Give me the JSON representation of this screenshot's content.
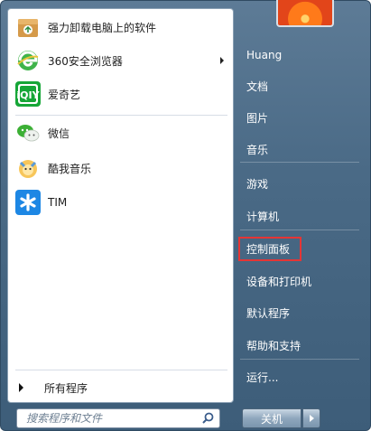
{
  "left_items": [
    {
      "label": "强力卸载电脑上的软件",
      "icon": "uninstall-box-icon",
      "has_arrow": false
    },
    {
      "label": "360安全浏览器",
      "icon": "browser-360-icon",
      "has_arrow": true
    },
    {
      "label": "爱奇艺",
      "icon": "iqiyi-icon",
      "has_arrow": false
    },
    {
      "label": "微信",
      "icon": "wechat-icon",
      "has_arrow": false
    },
    {
      "label": "酷我音乐",
      "icon": "kuwo-music-icon",
      "has_arrow": false
    },
    {
      "label": "TIM",
      "icon": "tim-icon",
      "has_arrow": false
    }
  ],
  "all_programs": "所有程序",
  "search": {
    "placeholder": "搜索程序和文件"
  },
  "right_items": [
    {
      "label": "Huang"
    },
    {
      "label": "文档"
    },
    {
      "label": "图片"
    },
    {
      "label": "音乐"
    },
    {
      "label": "游戏"
    },
    {
      "label": "计算机"
    },
    {
      "label": "控制面板"
    },
    {
      "label": "设备和打印机"
    },
    {
      "label": "默认程序"
    },
    {
      "label": "帮助和支持"
    },
    {
      "label": "运行..."
    }
  ],
  "shutdown_label": "关机",
  "colors": {
    "highlight": "#e53535",
    "frame": "#4a6a86"
  }
}
